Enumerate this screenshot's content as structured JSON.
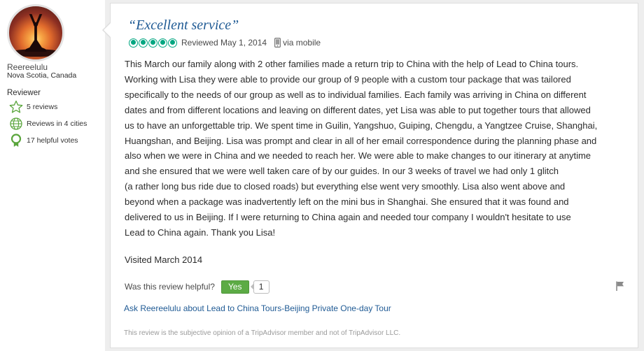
{
  "reviewer": {
    "username": "Reereelulu",
    "location": "Nova Scotia, Canada",
    "badge": "Reviewer",
    "stats": [
      {
        "icon": "star-outline-icon",
        "label": "5 reviews"
      },
      {
        "icon": "globe-icon",
        "label": "Reviews in 4 cities"
      },
      {
        "icon": "ribbon-icon",
        "label": "17 helpful votes"
      }
    ]
  },
  "review": {
    "title": "“Excellent service”",
    "rating": {
      "value": 5,
      "max": 5
    },
    "reviewed_date": "Reviewed May 1, 2014",
    "via": "via mobile",
    "body_lines": [
      "This March our family along with 2 other families made a return trip to China with the help of Lead to China tours.",
      "Working with Lisa they were able to provide our group of 9 people with a custom tour package that was tailored",
      "specifically to the needs of our group as well as to individual families. Each family was arriving in China on different",
      "dates and from different locations and leaving on different dates, yet Lisa was able to put together tours that allowed",
      "us to have an unforgettable trip. We spent time in Guilin, Yangshuo, Guiping, Chengdu, a Yangtzee Cruise, Shanghai,",
      "Huangshan, and Beijing. Lisa was prompt and clear in all of her email correspondence during the planning phase and",
      "also when we were in China and we needed to reach her. We were able to make changes to our itinerary at anytime",
      "and she ensured that we were well taken care of by our guides. In our 3 weeks of travel we had only 1 glitch",
      "(a rather long bus ride due to closed roads) but everything else went very smoothly. Lisa also went above and",
      "beyond when a package was inadvertently left on the mini bus in Shanghai. She ensured that it was found and",
      "delivered to us in Beijing. If I were returning to China again and needed tour company I wouldn't hesitate to use",
      "Lead to China again. Thank you Lisa!"
    ],
    "visited": "Visited March 2014",
    "helpful_question": "Was this review helpful?",
    "yes_label": "Yes",
    "helpful_count": "1",
    "ask_link": "Ask Reereelulu about Lead to China Tours-Beijing Private One-day Tour",
    "disclaimer": "This review is the subjective opinion of a TripAdvisor member and not of TripAdvisor LLC."
  },
  "colors": {
    "rating_green": "#00a680",
    "link_blue": "#1f5a94",
    "yes_button": "#5cab45",
    "badge_green": "#5aa53c"
  }
}
